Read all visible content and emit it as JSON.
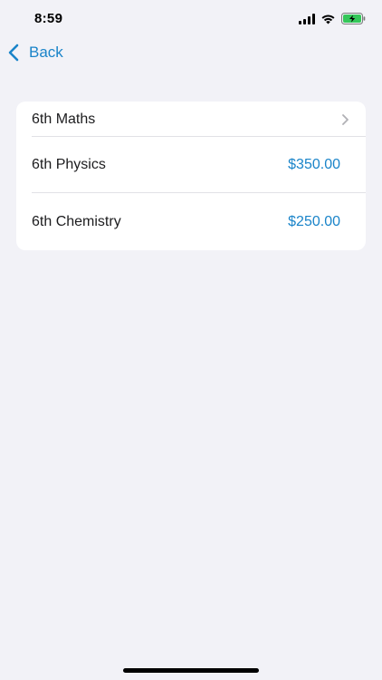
{
  "status_bar": {
    "time": "8:59",
    "icons": [
      "signal-icon",
      "wifi-icon",
      "battery-charging-icon"
    ]
  },
  "nav": {
    "back_label": "Back",
    "accent_color": "#1a84c9"
  },
  "list": {
    "items": [
      {
        "label": "6th Maths",
        "value": "",
        "has_chevron": true
      },
      {
        "label": "6th Physics",
        "value": "$350.00",
        "has_chevron": false
      },
      {
        "label": "6th Chemistry",
        "value": "$250.00",
        "has_chevron": false
      }
    ]
  }
}
